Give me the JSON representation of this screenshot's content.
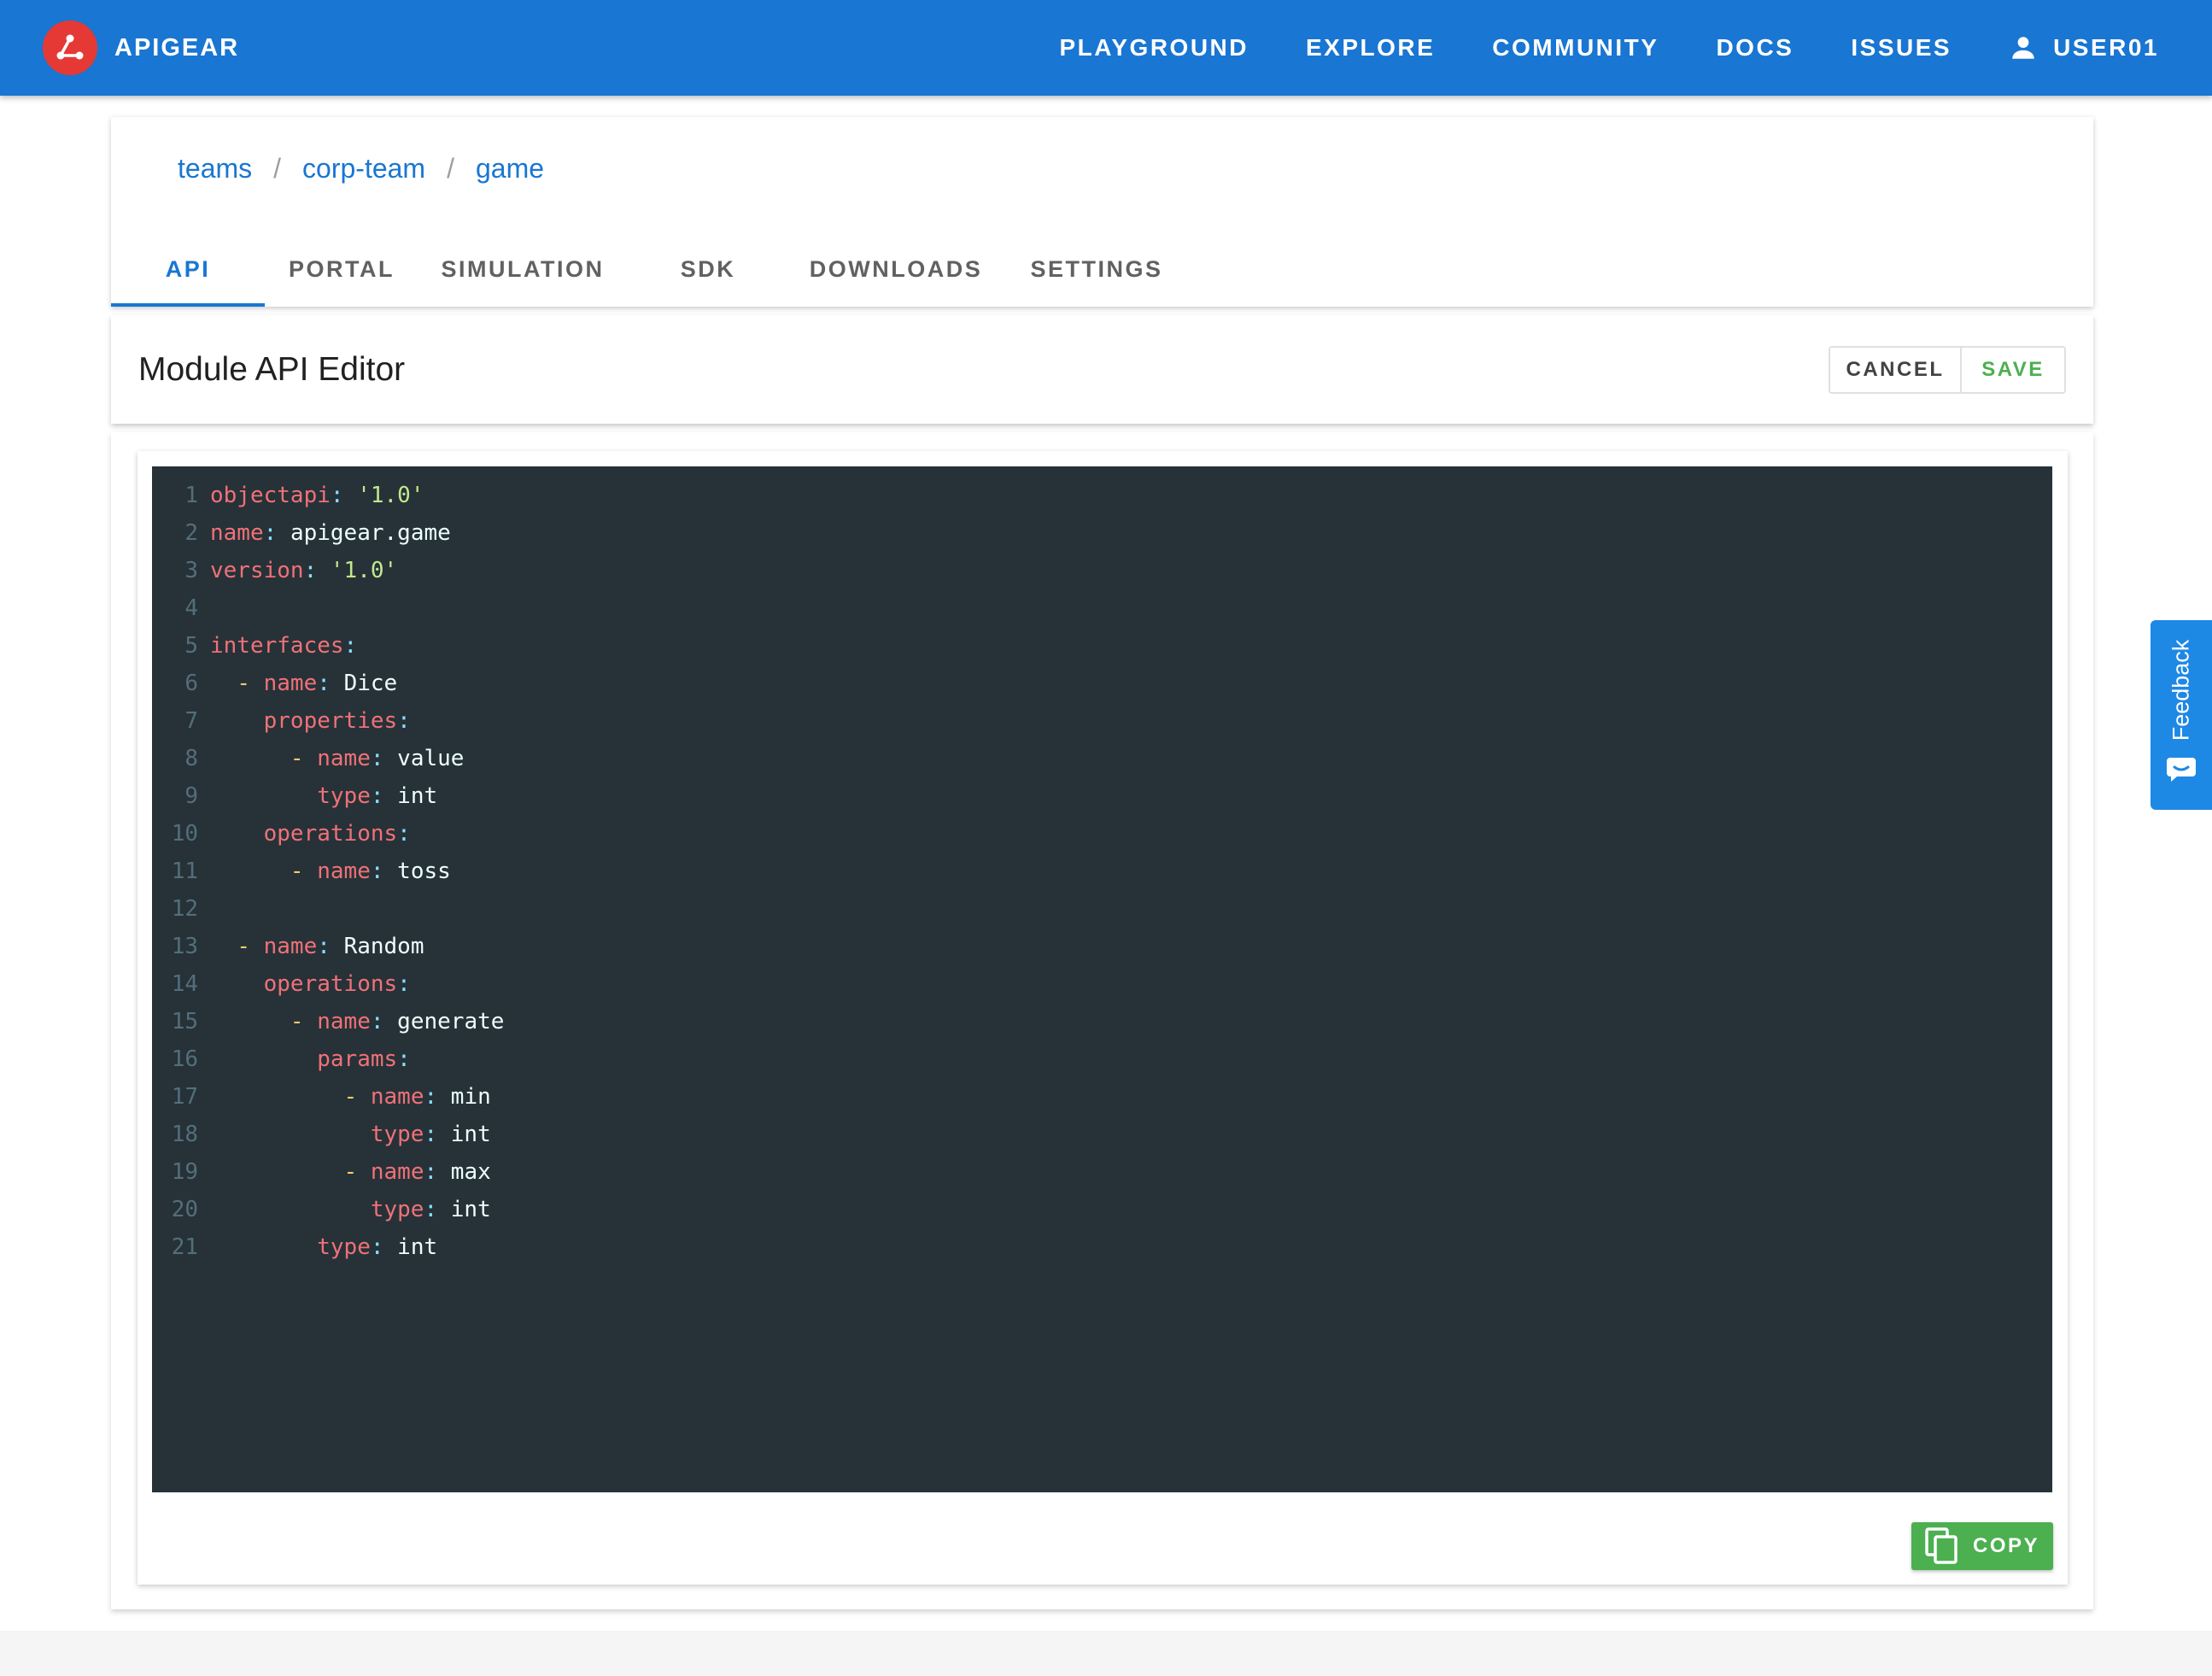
{
  "app": {
    "brand": "APIGEAR",
    "brand_logo_icon": "apigear-logo-icon",
    "nav": [
      {
        "label": "PLAYGROUND"
      },
      {
        "label": "EXPLORE"
      },
      {
        "label": "COMMUNITY"
      },
      {
        "label": "DOCS"
      },
      {
        "label": "ISSUES"
      }
    ],
    "user": {
      "label": "USER01",
      "icon": "person-icon"
    }
  },
  "breadcrumb": [
    "teams",
    "corp-team",
    "game"
  ],
  "tabs": [
    {
      "label": "API",
      "active": true
    },
    {
      "label": "PORTAL",
      "active": false
    },
    {
      "label": "SIMULATION",
      "active": false
    },
    {
      "label": "SDK",
      "active": false
    },
    {
      "label": "DOWNLOADS",
      "active": false
    },
    {
      "label": "SETTINGS",
      "active": false
    }
  ],
  "editor": {
    "title": "Module API Editor",
    "cancel_label": "CANCEL",
    "save_label": "SAVE",
    "copy_label": "COPY",
    "copy_icon": "copy-icon",
    "lines": [
      {
        "n": "1",
        "segs": [
          [
            "k",
            "objectapi"
          ],
          [
            "p",
            ": "
          ],
          [
            "s",
            "'1.0'"
          ]
        ]
      },
      {
        "n": "2",
        "segs": [
          [
            "k",
            "name"
          ],
          [
            "p",
            ": "
          ],
          [
            "v",
            "apigear.game"
          ]
        ]
      },
      {
        "n": "3",
        "segs": [
          [
            "k",
            "version"
          ],
          [
            "p",
            ": "
          ],
          [
            "s",
            "'1.0'"
          ]
        ]
      },
      {
        "n": "4",
        "segs": []
      },
      {
        "n": "5",
        "segs": [
          [
            "k",
            "interfaces"
          ],
          [
            "p",
            ":"
          ]
        ]
      },
      {
        "n": "6",
        "segs": [
          [
            "v",
            "  "
          ],
          [
            "d",
            "- "
          ],
          [
            "k",
            "name"
          ],
          [
            "p",
            ": "
          ],
          [
            "v",
            "Dice"
          ]
        ]
      },
      {
        "n": "7",
        "segs": [
          [
            "v",
            "    "
          ],
          [
            "k",
            "properties"
          ],
          [
            "p",
            ":"
          ]
        ]
      },
      {
        "n": "8",
        "segs": [
          [
            "v",
            "      "
          ],
          [
            "d",
            "- "
          ],
          [
            "k",
            "name"
          ],
          [
            "p",
            ": "
          ],
          [
            "v",
            "value"
          ]
        ]
      },
      {
        "n": "9",
        "segs": [
          [
            "v",
            "        "
          ],
          [
            "k",
            "type"
          ],
          [
            "p",
            ": "
          ],
          [
            "v",
            "int"
          ]
        ]
      },
      {
        "n": "10",
        "segs": [
          [
            "v",
            "    "
          ],
          [
            "k",
            "operations"
          ],
          [
            "p",
            ":"
          ]
        ]
      },
      {
        "n": "11",
        "segs": [
          [
            "v",
            "      "
          ],
          [
            "d",
            "- "
          ],
          [
            "k",
            "name"
          ],
          [
            "p",
            ": "
          ],
          [
            "v",
            "toss"
          ]
        ]
      },
      {
        "n": "12",
        "segs": []
      },
      {
        "n": "13",
        "segs": [
          [
            "v",
            "  "
          ],
          [
            "d",
            "- "
          ],
          [
            "k",
            "name"
          ],
          [
            "p",
            ": "
          ],
          [
            "v",
            "Random"
          ]
        ]
      },
      {
        "n": "14",
        "segs": [
          [
            "v",
            "    "
          ],
          [
            "k",
            "operations"
          ],
          [
            "p",
            ":"
          ]
        ]
      },
      {
        "n": "15",
        "segs": [
          [
            "v",
            "      "
          ],
          [
            "d",
            "- "
          ],
          [
            "k",
            "name"
          ],
          [
            "p",
            ": "
          ],
          [
            "v",
            "generate"
          ]
        ]
      },
      {
        "n": "16",
        "segs": [
          [
            "v",
            "        "
          ],
          [
            "k",
            "params"
          ],
          [
            "p",
            ":"
          ]
        ]
      },
      {
        "n": "17",
        "segs": [
          [
            "v",
            "          "
          ],
          [
            "d",
            "- "
          ],
          [
            "k",
            "name"
          ],
          [
            "p",
            ": "
          ],
          [
            "v",
            "min"
          ]
        ]
      },
      {
        "n": "18",
        "segs": [
          [
            "v",
            "            "
          ],
          [
            "k",
            "type"
          ],
          [
            "p",
            ": "
          ],
          [
            "v",
            "int"
          ]
        ]
      },
      {
        "n": "19",
        "segs": [
          [
            "v",
            "          "
          ],
          [
            "d",
            "- "
          ],
          [
            "k",
            "name"
          ],
          [
            "p",
            ": "
          ],
          [
            "v",
            "max"
          ]
        ]
      },
      {
        "n": "20",
        "segs": [
          [
            "v",
            "            "
          ],
          [
            "k",
            "type"
          ],
          [
            "p",
            ": "
          ],
          [
            "v",
            "int"
          ]
        ]
      },
      {
        "n": "21",
        "segs": [
          [
            "v",
            "        "
          ],
          [
            "k",
            "type"
          ],
          [
            "p",
            ": "
          ],
          [
            "v",
            "int"
          ]
        ]
      }
    ]
  },
  "feedback": {
    "label": "Feedback",
    "icon": "chat-icon"
  },
  "colors": {
    "primary": "#1976d2",
    "logo_bg": "#e53935",
    "save_green": "#4caf50",
    "editor_bg": "#263238",
    "feedback_tab": "#1e88e5"
  }
}
